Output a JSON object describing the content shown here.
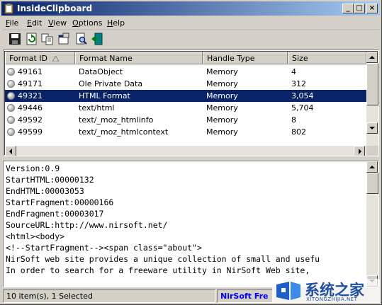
{
  "window": {
    "title": "InsideClipboard",
    "minimize_glyph": "_",
    "maximize_glyph": "□",
    "close_glyph": "×"
  },
  "menu": {
    "items": [
      {
        "label": "File",
        "key": "F",
        "rest": "ile"
      },
      {
        "label": "Edit",
        "key": "E",
        "rest": "dit"
      },
      {
        "label": "View",
        "key": "V",
        "rest": "iew"
      },
      {
        "label": "Options",
        "key": "O",
        "rest": "ptions"
      },
      {
        "label": "Help",
        "key": "H",
        "rest": "elp"
      }
    ]
  },
  "toolbar": {
    "icons": [
      "save-icon",
      "refresh-icon",
      "copy-icon",
      "properties-icon",
      "find-icon",
      "exit-icon"
    ]
  },
  "list": {
    "columns": [
      "Format ID",
      "Format Name",
      "Handle Type",
      "Size"
    ],
    "rows": [
      {
        "id": "49161",
        "name": "DataObject",
        "handle": "Memory",
        "size": "4",
        "selected": false
      },
      {
        "id": "49171",
        "name": "Ole Private Data",
        "handle": "Memory",
        "size": "312",
        "selected": false
      },
      {
        "id": "49321",
        "name": "HTML Format",
        "handle": "Memory",
        "size": "3,054",
        "selected": true
      },
      {
        "id": "49446",
        "name": "text/html",
        "handle": "Memory",
        "size": "5,704",
        "selected": false
      },
      {
        "id": "49592",
        "name": "text/_moz_htmlinfo",
        "handle": "Memory",
        "size": "8",
        "selected": false
      },
      {
        "id": "49599",
        "name": "text/_moz_htmlcontext",
        "handle": "Memory",
        "size": "802",
        "selected": false
      }
    ]
  },
  "content": {
    "lines": [
      "Version:0.9",
      "StartHTML:00000132",
      "EndHTML:00003053",
      "StartFragment:00000166",
      "EndFragment:00003017",
      "SourceURL:http://www.nirsoft.net/",
      "<html><body>",
      "<!--StartFragment--><span class=\"about\">",
      "NirSoft web site provides a unique collection of small and usefu",
      "In order to search for a freeware utility in NirSoft Web site,"
    ]
  },
  "status": {
    "items_text": "10 item(s), 1 Selected",
    "link_text": "NirSoft Fre"
  },
  "watermark": {
    "title": "系统之家",
    "subtitle": "XITONGZHIJIA.NET"
  },
  "colors": {
    "selection": "#0a246a",
    "face": "#d4d0c8",
    "link": "#0000ff"
  }
}
